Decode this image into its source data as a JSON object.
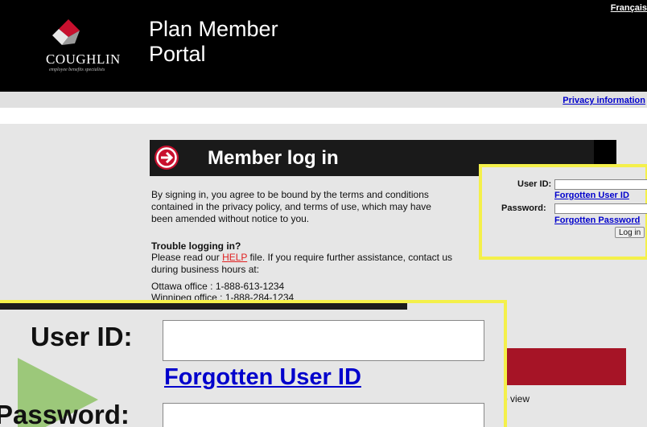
{
  "header": {
    "logo_text": "COUGHLIN",
    "logo_tagline": "employee benefits specialists",
    "title": "Plan Member\nPortal",
    "language_link": "Français"
  },
  "subbar": {
    "privacy_link": "Privacy information"
  },
  "banner": {
    "title": "Member log in"
  },
  "content": {
    "terms_text": "By signing in, you agree to be bound by the terms and conditions contained in the privacy policy, and terms of use, which may have been amended without notice to you.",
    "trouble_heading": "Trouble logging in?",
    "help_prefix": "Please read our ",
    "help_link": "HELP",
    "help_suffix": " file. If you require further assistance, contact us during business hours at:",
    "ottawa_line": "Ottawa office   : 1-888-613-1234",
    "winnipeg_line_partial": "Winnipeg office : 1-888-284-1234",
    "to_view_fragment": "o view"
  },
  "login": {
    "user_id_label": "User ID:",
    "user_id_value": "",
    "forgot_user_id_link": "Forgotten User ID",
    "password_label": "Password:",
    "password_value": "",
    "forgot_password_link": "Forgotten Password",
    "login_button": "Log in"
  },
  "zoom": {
    "user_id_label": "User ID:",
    "forgot_user_id_link": "Forgotten User ID",
    "password_label": "Password:"
  },
  "colors": {
    "header_bg": "#000000",
    "highlight": "#f4f04a",
    "link": "#0000cc",
    "help_link": "#e02020",
    "red_bar": "#a61426",
    "zoom_arrow": "#9cc87a"
  },
  "icons": {
    "banner_arrow": "arrow-right-circle-icon",
    "logo": "coughlin-logo-icon",
    "zoom_pointer": "zoom-pointer-arrow-icon"
  }
}
